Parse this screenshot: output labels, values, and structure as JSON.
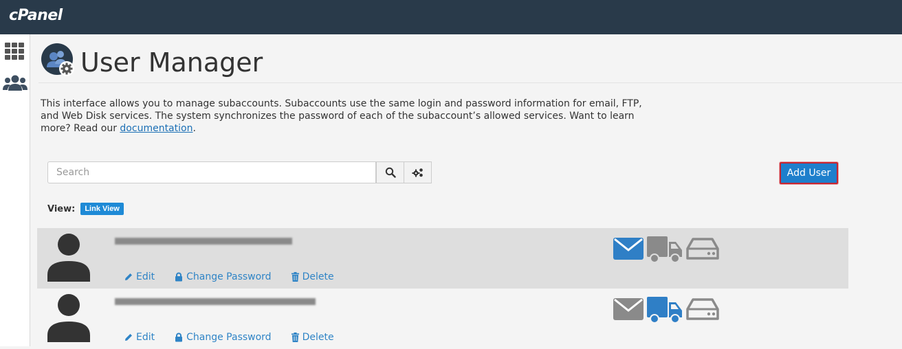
{
  "brand": {
    "logo_text": "cPanel"
  },
  "sidebar": {
    "items": [
      {
        "name": "apps-grid-icon"
      },
      {
        "name": "users-icon"
      }
    ]
  },
  "header": {
    "title": "User Manager"
  },
  "description": {
    "text": "This interface allows you to manage subaccounts. Subaccounts use the same login and password information for email, FTP, and Web Disk services. The system synchronizes the password of each of the subaccount’s allowed services. Want to learn more? Read our ",
    "link_text": "documentation",
    "suffix": "."
  },
  "search": {
    "placeholder": "Search"
  },
  "toolbar": {
    "add_user_label": "Add User"
  },
  "view": {
    "label": "View:",
    "mode": "Link View"
  },
  "users": [
    {
      "selected": true,
      "actions": {
        "edit": "Edit",
        "change_password": "Change Password",
        "delete": "Delete"
      },
      "services": {
        "email": true,
        "ftp": false,
        "web_disk": false
      }
    },
    {
      "selected": false,
      "actions": {
        "edit": "Edit",
        "change_password": "Change Password",
        "delete": "Delete"
      },
      "services": {
        "email": false,
        "ftp": true,
        "web_disk": false
      }
    }
  ],
  "colors": {
    "topbar": "#293a4a",
    "accent": "#1e7fcc",
    "service_active": "#2f7fc6",
    "service_inactive": "#8a8a8a",
    "highlight_border": "#c52530"
  }
}
